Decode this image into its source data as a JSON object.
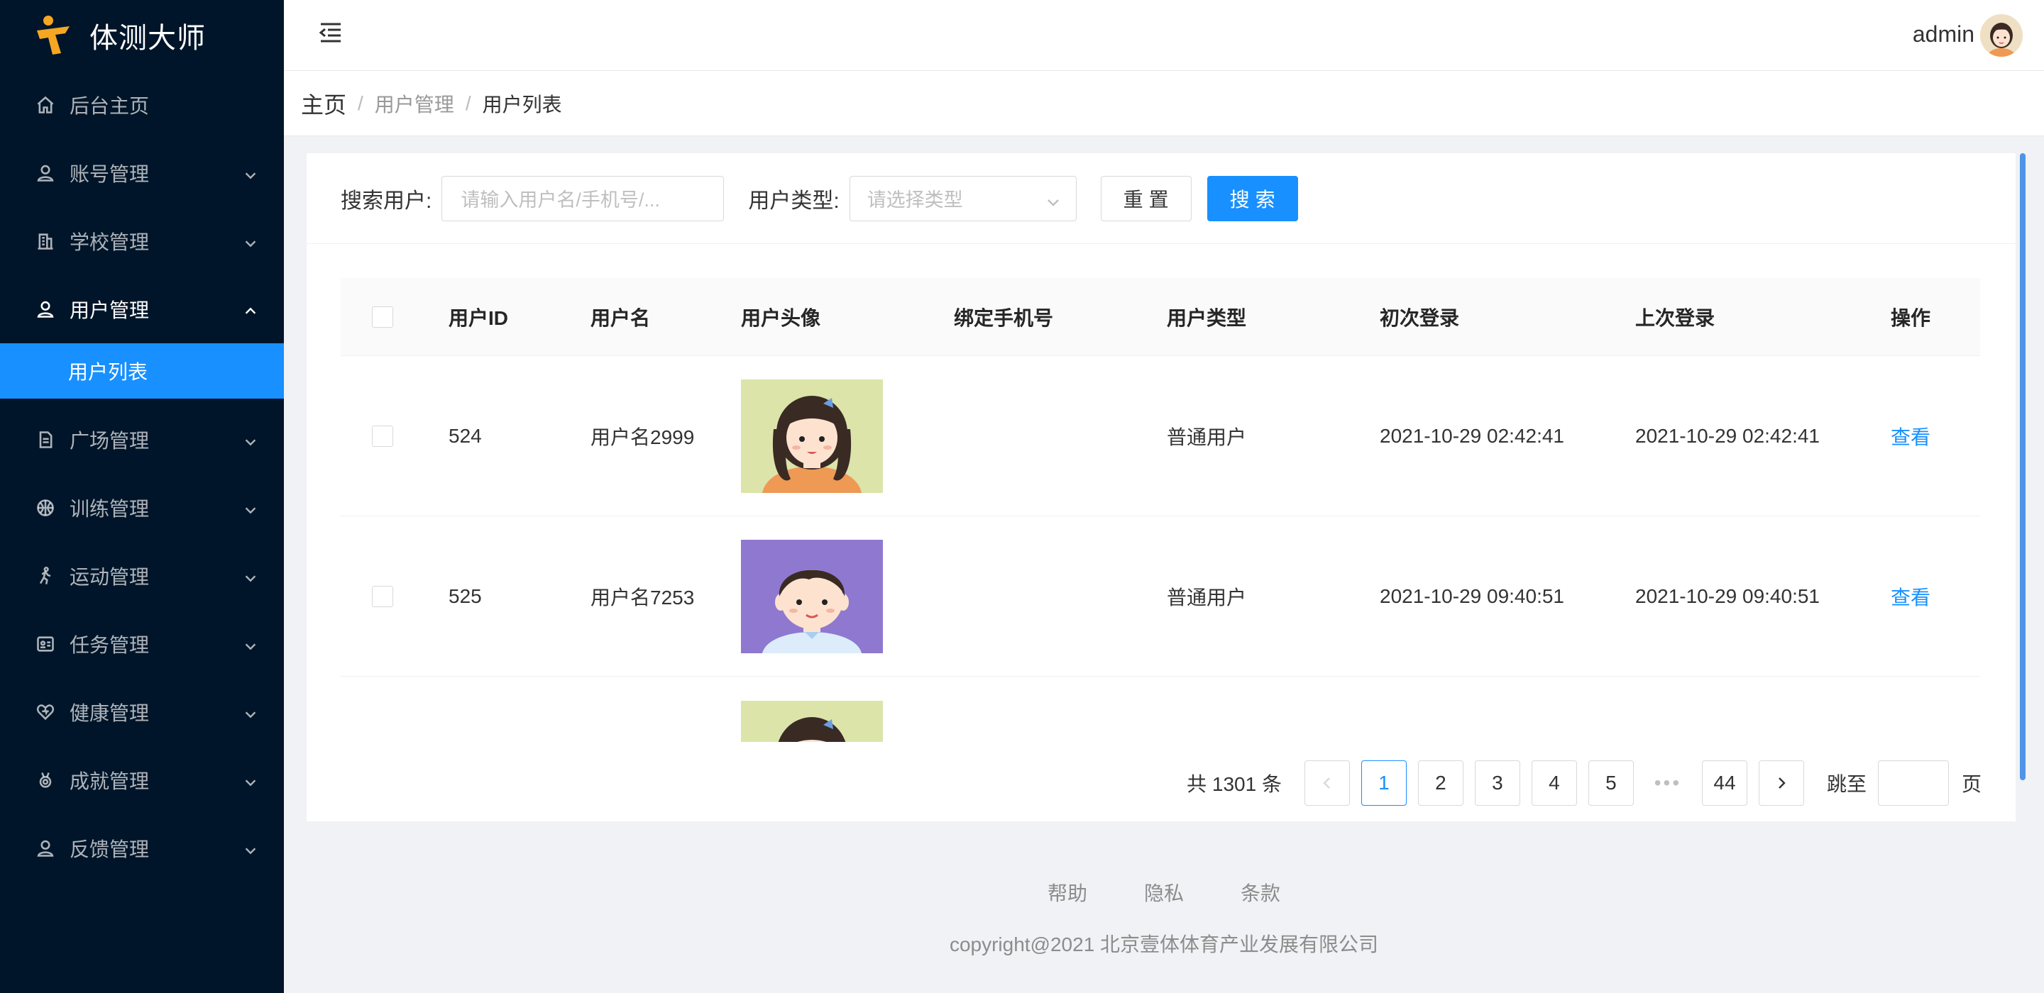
{
  "app": {
    "title": "体测大师"
  },
  "sidebar": {
    "items": [
      {
        "label": "后台主页",
        "icon": "home-icon"
      },
      {
        "label": "账号管理",
        "icon": "user-icon"
      },
      {
        "label": "学校管理",
        "icon": "building-icon"
      },
      {
        "label": "用户管理",
        "icon": "user-icon",
        "open": true
      },
      {
        "label": "广场管理",
        "icon": "document-icon"
      },
      {
        "label": "训练管理",
        "icon": "ball-icon"
      },
      {
        "label": "运动管理",
        "icon": "runner-icon"
      },
      {
        "label": "任务管理",
        "icon": "idcard-icon"
      },
      {
        "label": "健康管理",
        "icon": "heart-icon"
      },
      {
        "label": "成就管理",
        "icon": "medal-icon"
      },
      {
        "label": "反馈管理",
        "icon": "user-icon"
      }
    ],
    "active_sub": "用户列表"
  },
  "header": {
    "username": "admin"
  },
  "breadcrumb": {
    "home": "主页",
    "level1": "用户管理",
    "current": "用户列表"
  },
  "search": {
    "user_label": "搜索用户",
    "user_placeholder": "请输入用户名/手机号/...",
    "type_label": "用户类型",
    "type_placeholder": "请选择类型",
    "reset": "重置",
    "search": "搜索"
  },
  "table": {
    "columns": [
      "用户ID",
      "用户名",
      "用户头像",
      "绑定手机号",
      "用户类型",
      "初次登录",
      "上次登录",
      "操作"
    ],
    "rows": [
      {
        "id": "524",
        "name": "用户名2999",
        "phone": "",
        "type": "普通用户",
        "first": "2021-10-29 02:42:41",
        "last": "2021-10-29 02:42:41",
        "op": "查看"
      },
      {
        "id": "525",
        "name": "用户名7253",
        "phone": "",
        "type": "普通用户",
        "first": "2021-10-29 09:40:51",
        "last": "2021-10-29 09:40:51",
        "op": "查看"
      }
    ]
  },
  "pagination": {
    "total": "共 1301 条",
    "pages": [
      "1",
      "2",
      "3",
      "4",
      "5"
    ],
    "ellipsis": "•••",
    "last": "44",
    "jump_label": "跳至",
    "jump_unit": "页"
  },
  "footer": {
    "help": "帮助",
    "privacy": "隐私",
    "terms": "条款",
    "copyright": "copyright@2021 北京壹体体育产业发展有限公司"
  },
  "colors": {
    "sidebar_bg": "#001529",
    "accent": "#1890ff",
    "logo_orange": "#f5a623"
  }
}
